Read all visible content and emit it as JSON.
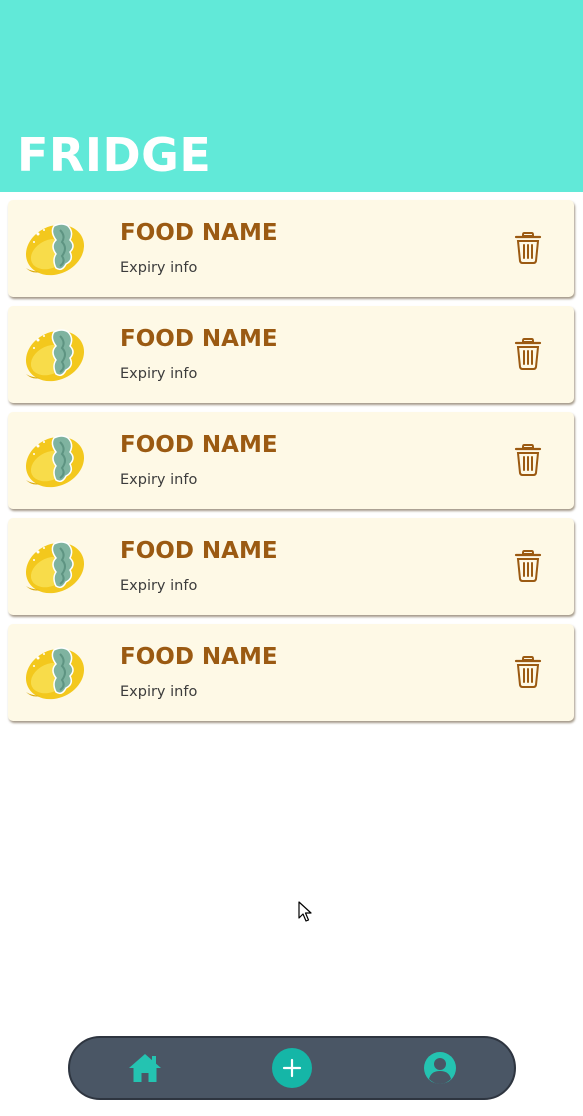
{
  "header": {
    "title": "FRIDGE"
  },
  "items": [
    {
      "name": "FOOD NAME",
      "expiry": "Expiry info"
    },
    {
      "name": "FOOD NAME",
      "expiry": "Expiry info"
    },
    {
      "name": "FOOD NAME",
      "expiry": "Expiry info"
    },
    {
      "name": "FOOD NAME",
      "expiry": "Expiry info"
    },
    {
      "name": "FOOD NAME",
      "expiry": "Expiry info"
    }
  ],
  "icons": {
    "food": "moldy-lemon-icon",
    "delete": "trash-icon",
    "nav_home": "home-icon",
    "nav_add": "plus-icon",
    "nav_profile": "profile-icon"
  },
  "colors": {
    "header_bg": "#61e9d8",
    "card_bg": "#fef9e6",
    "food_name": "#9b5a12",
    "nav_bg": "#4a5665",
    "nav_accent": "#15b6a7"
  }
}
